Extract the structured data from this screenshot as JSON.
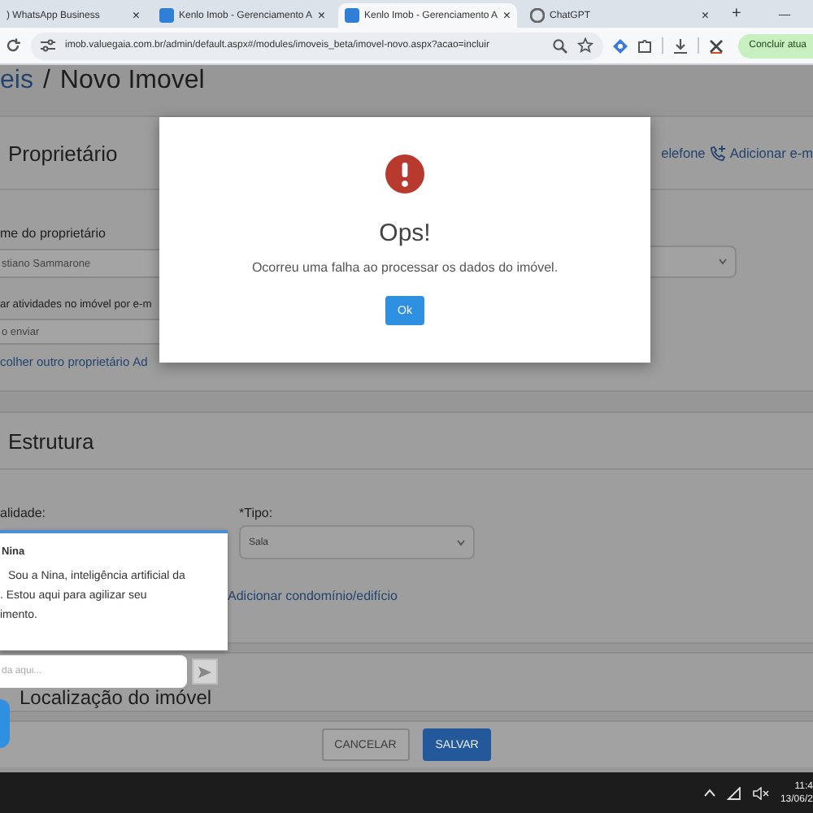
{
  "browser": {
    "tabs": [
      {
        "title": ") WhatsApp Business",
        "kind": "plain",
        "close": "×",
        "selected": false
      },
      {
        "title": "Kenlo Imob - Gerenciamento A",
        "kind": "app",
        "close": "×",
        "selected": false
      },
      {
        "title": "Kenlo Imob - Gerenciamento A",
        "kind": "app",
        "close": "×",
        "selected": true
      },
      {
        "title": "ChatGPT",
        "kind": "chat",
        "close": "×",
        "selected": false
      }
    ],
    "new_tab": "+",
    "minimize": "—",
    "url": "imob.valuegaia.com.br/admin/default.aspx#/modules/imoveis_beta/imovel-novo.aspx?acao=incluir",
    "update_button": "Concluir atua"
  },
  "page": {
    "breadcrumb": {
      "parent": "eis",
      "separator": "/",
      "current": "Novo Imovel"
    },
    "owner_card": {
      "title": "Proprietário",
      "actions": [
        "elefone",
        "Adicionar e-m"
      ],
      "name_label": "me do proprietário",
      "name_value": "stiano Sammarone",
      "email_label": "ar atividades no imóvel por e-m",
      "email_value": "o enviar",
      "links": [
        "colher outro proprietário",
        "Ad"
      ]
    },
    "structure_card": {
      "title": "Estrutura",
      "purpose_label": "alidade:",
      "type_label": "*Tipo:",
      "type_value": "Sala",
      "link": "Adicionar condomínio/edifício"
    },
    "location_card": {
      "title": "Localização do imóvel"
    },
    "footer": {
      "buttons": [
        {
          "label": "CANCELAR",
          "kind": "secondary"
        },
        {
          "label": "SALVAR",
          "kind": "primary"
        }
      ]
    }
  },
  "dialog": {
    "title": "Ops!",
    "message": "Ocorreu uma falha ao processar os dados do imóvel.",
    "button": "Ok"
  },
  "chat": {
    "title": "Nina",
    "message_lines": [
      "Sou a Nina, inteligência artificial da",
      ". Estou aqui para agilizar seu",
      "imento."
    ],
    "placeholder": "da aqui..."
  },
  "taskbar": {
    "time": "11:4",
    "date": "13/06/2"
  }
}
